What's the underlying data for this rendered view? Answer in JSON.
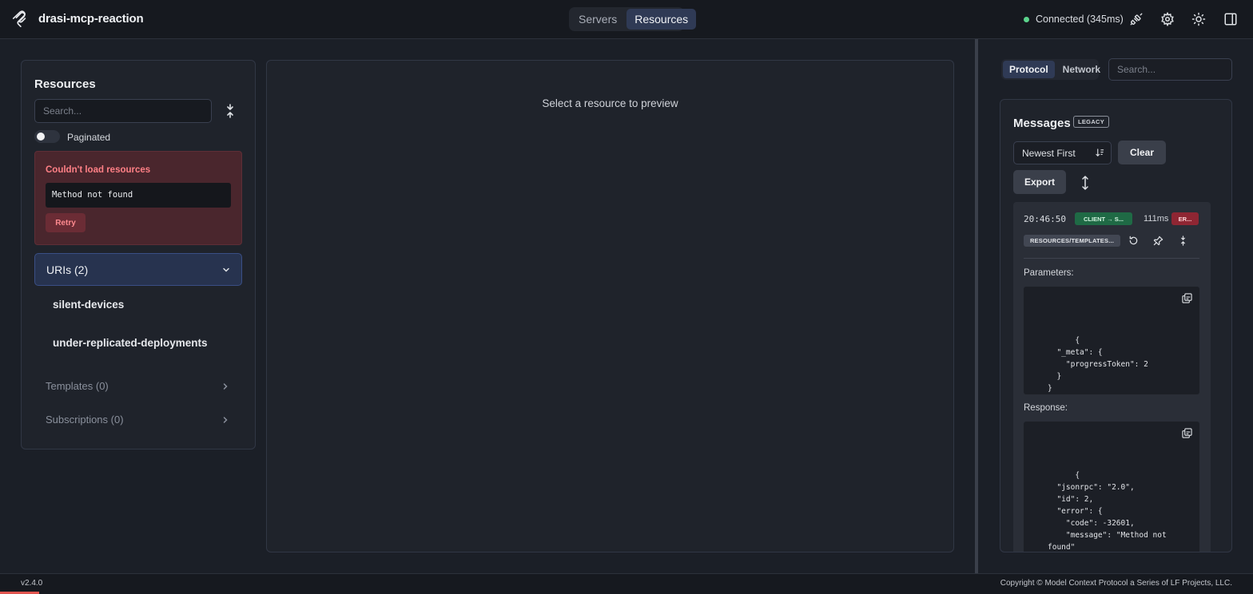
{
  "header": {
    "app_name": "drasi-mcp-reaction",
    "nav_tabs": [
      {
        "label": "Servers",
        "active": false
      },
      {
        "label": "Resources",
        "active": true
      }
    ],
    "connection_status": "Connected (345ms)",
    "connection_color": "#5bd48c",
    "icons": [
      "unplug-icon",
      "gear-icon",
      "sun-icon",
      "panel-toggle-icon"
    ]
  },
  "resources_panel": {
    "title": "Resources",
    "search_placeholder": "Search...",
    "paginated_label": "Paginated",
    "paginated_on": false,
    "error": {
      "title": "Couldn't load resources",
      "message": "Method not found",
      "retry_label": "Retry"
    },
    "uris_section": {
      "label": "URIs (2)",
      "items": [
        "silent-devices",
        "under-replicated-deployments"
      ]
    },
    "templates_label": "Templates (0)",
    "subscriptions_label": "Subscriptions (0)"
  },
  "preview": {
    "empty_text": "Select a resource to preview"
  },
  "right_panel": {
    "tabs": [
      {
        "label": "Protocol",
        "active": true
      },
      {
        "label": "Network",
        "active": false
      }
    ],
    "search_placeholder": "Search...",
    "messages": {
      "title": "Messages",
      "badge": "LEGACY",
      "sort_value": "Newest First",
      "clear_label": "Clear",
      "export_label": "Export",
      "entry": {
        "time": "20:46:50",
        "direction": "CLIENT → S...",
        "duration": "111ms",
        "status": "ER...",
        "method": "RESOURCES/TEMPLATES...",
        "parameters_label": "Parameters:",
        "parameters_json": "{\n  \"_meta\": {\n    \"progressToken\": 2\n  }\n}",
        "response_label": "Response:",
        "response_json": "{\n  \"jsonrpc\": \"2.0\",\n  \"id\": 2,\n  \"error\": {\n    \"code\": -32601,\n    \"message\": \"Method not\nfound\"\n  }\n}"
      }
    }
  },
  "footer": {
    "version": "v2.4.0",
    "copyright": "Copyright © Model Context Protocol a Series of LF Projects, LLC."
  }
}
